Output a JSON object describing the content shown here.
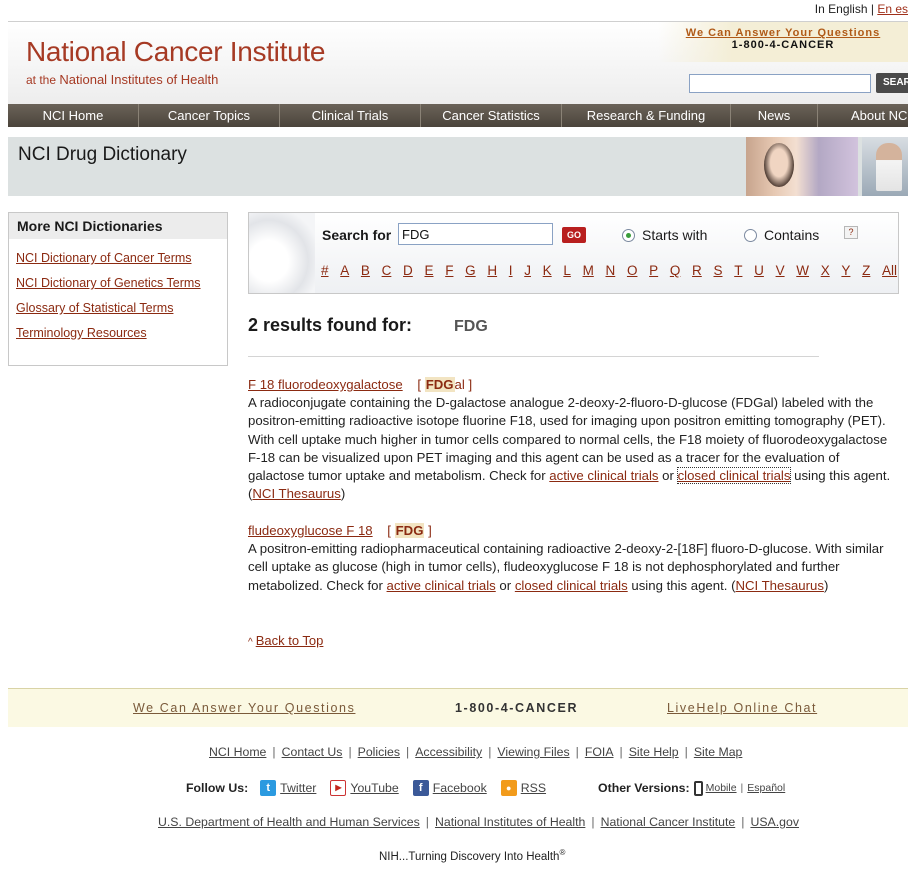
{
  "lang": {
    "english": "In English",
    "sep": "|",
    "spanish": "En es"
  },
  "header": {
    "title": "National Cancer Institute",
    "subtitle_prefix": "at the",
    "subtitle_main": "National Institutes of Health",
    "help_question": "We Can Answer Your Questions",
    "help_phone": "1-800-4-CANCER",
    "search_placeholder": "",
    "search_button": "SEARCH"
  },
  "nav": [
    "NCI Home",
    "Cancer Topics",
    "Clinical Trials",
    "Cancer Statistics",
    "Research & Funding",
    "News",
    "About NCI"
  ],
  "page_title": "NCI Drug Dictionary",
  "sidebar": {
    "title": "More NCI Dictionaries",
    "links": [
      "NCI Dictionary of Cancer Terms",
      "NCI Dictionary of Genetics Terms",
      "Glossary of Statistical Terms",
      "Terminology Resources"
    ]
  },
  "search": {
    "label": "Search for",
    "value": "FDG",
    "go": "GO",
    "opt_starts": "Starts with",
    "opt_contains": "Contains",
    "help": "?",
    "selected": "Starts with",
    "alphabet": [
      "#",
      "A",
      "B",
      "C",
      "D",
      "E",
      "F",
      "G",
      "H",
      "I",
      "J",
      "K",
      "L",
      "M",
      "N",
      "O",
      "P",
      "Q",
      "R",
      "S",
      "T",
      "U",
      "V",
      "W",
      "X",
      "Y",
      "Z",
      "All"
    ]
  },
  "results": {
    "count_text": "2 results found for:",
    "term": "FDG",
    "items": [
      {
        "name": "F 18 fluorodeoxygalactose",
        "acr_open": "[",
        "acr_bold": "FDG",
        "acr_rest": "al",
        "acr_close": "]",
        "desc": "A radioconjugate containing the D-galactose analogue 2-deoxy-2-fluoro-D-glucose (FDGal) labeled with the positron-emitting radioactive isotope fluorine F18, used for imaging upon positron emitting tomography (PET). With cell uptake much higher in tumor cells compared to normal cells, the F18 moiety of fluorodeoxygalactose F-18 can be visualized upon PET imaging and this agent can be used as a tracer for the evaluation of galactose tumor uptake and metabolism. Check for",
        "active": "active clinical trials",
        "or": "or",
        "closed": "closed clinical trials",
        "using": "using this agent. (",
        "thes": "NCI Thesaurus",
        "end": ")"
      },
      {
        "name": "fludeoxyglucose F 18",
        "acr_open": "[",
        "acr_bold": "FDG",
        "acr_rest": "",
        "acr_close": "]",
        "desc": "A positron-emitting radiopharmaceutical containing radioactive 2-deoxy-2-[18F] fluoro-D-glucose. With similar cell uptake as glucose (high in tumor cells), fludeoxyglucose F 18 is not dephosphorylated and further metabolized. Check for",
        "active": "active clinical trials",
        "or": "or",
        "closed": "closed clinical trials",
        "using": "using this agent. (",
        "thes": "NCI Thesaurus",
        "end": ")"
      }
    ],
    "back_to_top": "Back to Top"
  },
  "footer": {
    "questions": "We Can Answer Your Questions",
    "phone": "1-800-4-CANCER",
    "chat": "LiveHelp Online Chat",
    "links": [
      "NCI Home",
      "Contact Us",
      "Policies",
      "Accessibility",
      "Viewing Files",
      "FOIA",
      "Site Help",
      "Site Map"
    ],
    "follow_label": "Follow Us:",
    "social": [
      "Twitter",
      "YouTube",
      "Facebook",
      "RSS"
    ],
    "other_label": "Other Versions:",
    "mobile": "Mobile",
    "espanol": "Español",
    "gov_links": [
      "U.S. Department of Health and Human Services",
      "National Institutes of Health",
      "National Cancer Institute",
      "USA.gov"
    ],
    "tagline": "NIH...Turning Discovery Into Health",
    "tagline_mark": "®"
  }
}
